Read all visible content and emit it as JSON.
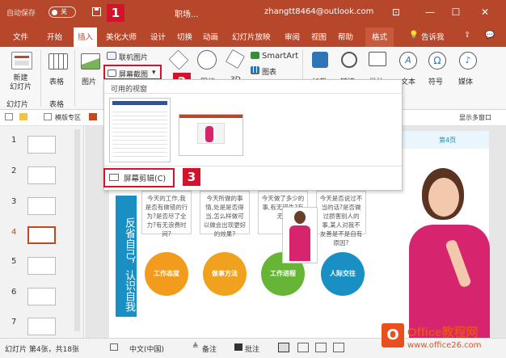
{
  "titlebar": {
    "autosave_label": "自动保存",
    "autosave_state": "关",
    "doc_title": "职场...",
    "account": "zhangtt8464@outlook.com",
    "icons": [
      "save-icon",
      "ribbon-display-icon",
      "minimize-icon",
      "maximize-icon",
      "close-icon"
    ]
  },
  "tabs": [
    "文件",
    "开始",
    "插入",
    "美化大师",
    "设计",
    "切换",
    "动画",
    "幻灯片放映",
    "审阅",
    "视图",
    "帮助",
    "格式"
  ],
  "tab_extra": {
    "tell_me": "告诉我"
  },
  "ribbon": {
    "new_slide": "新建\n幻灯片",
    "slides_group": "幻灯片",
    "table": "表格",
    "table_group": "表格",
    "picture": "图片",
    "online_picture": "联机图片",
    "screenshot": "屏幕截图",
    "shapes_partial": "图标",
    "model_3d": "3D",
    "smartart": "SmartArt",
    "chart": "图表",
    "addins": "加载",
    "link": "链接",
    "comment": "批注",
    "text": "文本",
    "symbol": "符号",
    "media": "媒体"
  },
  "quickbar": {
    "tab_label": "模版专区",
    "right_label": "显示多窗口"
  },
  "dropdown": {
    "header": "可用的视窗",
    "clip_label": "屏幕剪辑(C)"
  },
  "slides": {
    "numbers": [
      "1",
      "2",
      "3",
      "4",
      "5",
      "6",
      "7"
    ],
    "selected": "4"
  },
  "slide": {
    "page_label": "第4页",
    "vertical_title": "反省自己，认识自我",
    "bubbles": [
      "今天的工作,我是否有做错的行为?是否尽了全力?有无浪费时间?",
      "今天所做的事情,处是是否得当,怎么样做可以做会出现更好的效果?",
      "今天做了多少的事,有无错失?有无...",
      "今天是否说过不当的话?是否做过损害别人的事,某人对我不友善是不是自有原因?"
    ],
    "circles": [
      "工作态度",
      "做事方法",
      "工作进程",
      "人际交往"
    ]
  },
  "annotations": [
    "1",
    "2",
    "3"
  ],
  "statusbar": {
    "slide_info": "幻灯片 第4张，共18张",
    "language": "中文(中国)",
    "notes": "备注",
    "comments": "批注"
  },
  "watermark": {
    "brand": "Office教程网",
    "url": "www.office26.com"
  },
  "colors": {
    "accent": "#b7472a",
    "annotation_red": "#d3132b",
    "selected_slide": "#c4471f"
  }
}
